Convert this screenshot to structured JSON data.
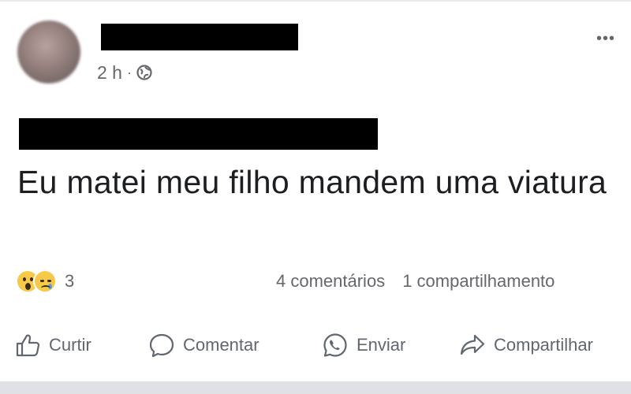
{
  "post": {
    "time": "2 h",
    "separator": "·",
    "more_label": "•••",
    "text": "Eu matei meu filho mandem uma viatura"
  },
  "reactions": {
    "icons": [
      "wow-reaction-icon",
      "sad-reaction-icon"
    ],
    "count": "3"
  },
  "stats": {
    "comments": "4 comentários",
    "shares": "1 compartilhamento"
  },
  "actions": {
    "like": "Curtir",
    "comment": "Comentar",
    "send": "Enviar",
    "share": "Compartilhar"
  },
  "colors": {
    "text": "#1c1e21",
    "secondary": "#65676b",
    "redaction": "#000000",
    "reaction_yellow": "#f7c948"
  }
}
